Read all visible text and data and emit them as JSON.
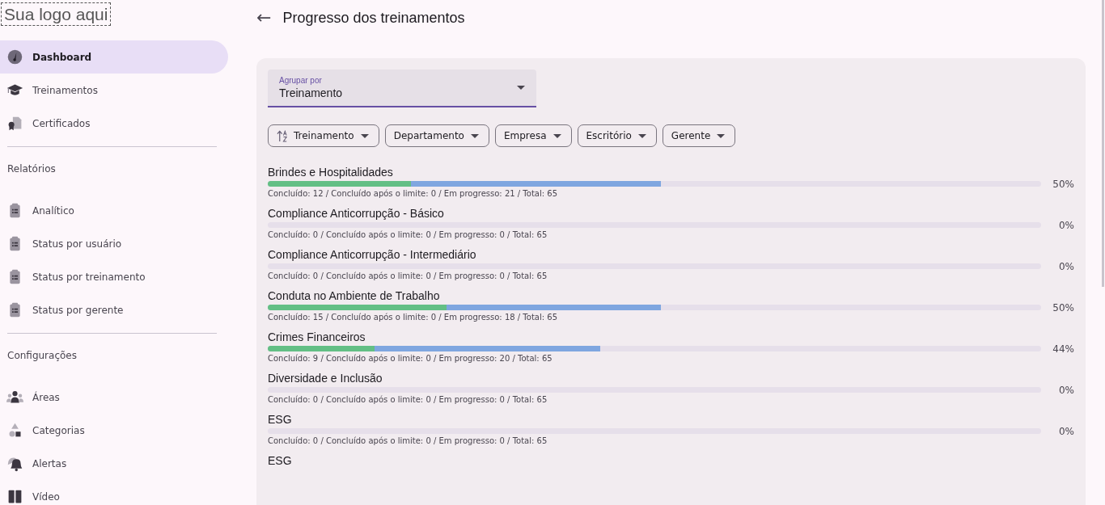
{
  "logo": "Sua logo aqui",
  "sidebar": {
    "items": [
      {
        "kind": "item",
        "label": "Dashboard",
        "selected": true
      },
      {
        "kind": "item",
        "label": "Treinamentos",
        "selected": false
      },
      {
        "kind": "item",
        "label": "Certificados",
        "selected": false
      },
      {
        "kind": "divider"
      },
      {
        "kind": "header",
        "label": "Relatórios"
      },
      {
        "kind": "item",
        "label": "Analítico",
        "selected": false
      },
      {
        "kind": "item",
        "label": "Status por usuário",
        "selected": false
      },
      {
        "kind": "item",
        "label": "Status por treinamento",
        "selected": false
      },
      {
        "kind": "item",
        "label": "Status por gerente",
        "selected": false
      },
      {
        "kind": "divider"
      },
      {
        "kind": "header",
        "label": "Configurações"
      },
      {
        "kind": "item",
        "label": "Áreas",
        "selected": false
      },
      {
        "kind": "item",
        "label": "Categorias",
        "selected": false
      },
      {
        "kind": "item",
        "label": "Alertas",
        "selected": false
      },
      {
        "kind": "item",
        "label": "Vídeo",
        "selected": false
      }
    ]
  },
  "page": {
    "back": "←",
    "title": "Progresso dos treinamentos"
  },
  "group_by": {
    "label": "Agrupar por",
    "value": "Treinamento"
  },
  "filters": [
    {
      "label": "Treinamento",
      "sort": true
    },
    {
      "label": "Departamento",
      "sort": false
    },
    {
      "label": "Empresa",
      "sort": false
    },
    {
      "label": "Escritório",
      "sort": false
    },
    {
      "label": "Gerente",
      "sort": false
    }
  ],
  "trainings": [
    {
      "name": "Brindes e Hospitalidades",
      "segments": [
        {
          "kind": "done",
          "level": 0.185
        },
        {
          "kind": "in_progress",
          "level": 0.323
        }
      ],
      "stats": "Concluído: 12 / Concluído após o limite: 0 / Em progresso: 21 / Total: 65",
      "percent": "50%"
    },
    {
      "name": "Compliance Anticorrupção - Básico",
      "stats": "Concluído: 0 / Concluído após o limite: 0 / Em progresso: 0 / Total: 65",
      "percent": "0%"
    },
    {
      "name": "Compliance Anticorrupção - Intermediário",
      "stats": "Concluído: 0 / Concluído após o limite: 0 / Em progresso: 0 / Total: 65",
      "percent": "0%"
    },
    {
      "name": "Conduta no Ambiente de Trabalho",
      "segments": [
        {
          "kind": "done",
          "level": 0.231
        },
        {
          "kind": "in_progress",
          "level": 0.277
        }
      ],
      "stats": "Concluído: 15 / Concluído após o limite: 0 / Em progresso: 18 / Total: 65",
      "percent": "50%"
    },
    {
      "name": "Crimes Financeiros",
      "segments": [
        {
          "kind": "done",
          "level": 0.138
        },
        {
          "kind": "in_progress",
          "level": 0.292
        }
      ],
      "stats": "Concluído: 9 / Concluído após o limite: 0 / Em progresso: 20 / Total: 65",
      "percent": "44%"
    },
    {
      "name": "Diversidade e Inclusão",
      "stats": "Concluído: 0 / Concluído após o limite: 0 / Em progresso: 0 / Total: 65",
      "percent": "0%"
    },
    {
      "name": "ESG",
      "stats": "Concluído: 0 / Concluído após o limite: 0 / Em progresso: 0 / Total: 65",
      "percent": "0%"
    },
    {
      "name": "ESG"
    }
  ]
}
